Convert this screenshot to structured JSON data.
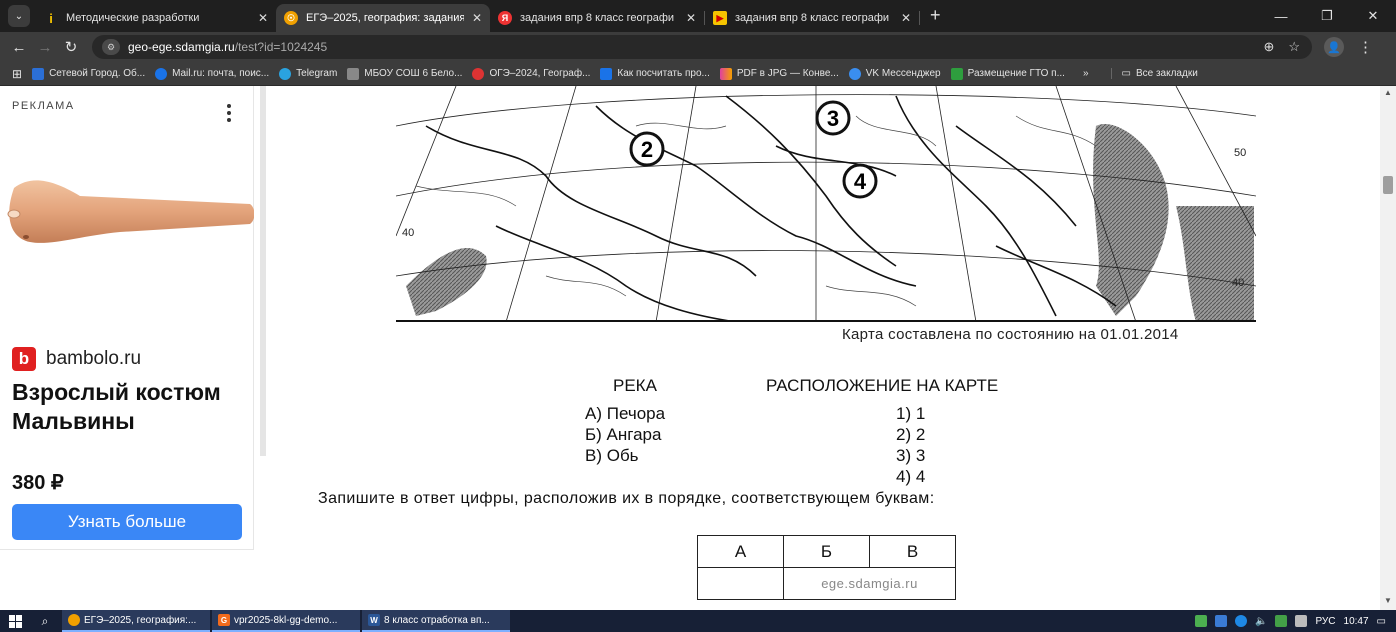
{
  "browser": {
    "tabs": [
      {
        "title": "Методические разработки",
        "favicon_color": "#f5c400",
        "favicon_glyph": "i",
        "active": false
      },
      {
        "title": "ЕГЭ–2025, география: задания",
        "favicon_color": "#f0a000",
        "favicon_glyph": "☉",
        "active": true
      },
      {
        "title": "задания впр 8 класс географи",
        "favicon_color": "#e33",
        "favicon_glyph": "Я",
        "active": false
      },
      {
        "title": "задания впр 8 класс географи",
        "favicon_color": "#f5c400",
        "favicon_glyph": "▶",
        "active": false
      }
    ],
    "url_domain": "geo-ege.sdamgia.ru",
    "url_path": "/test?id=1024245",
    "profile_initial": "👤"
  },
  "bookmarks": [
    {
      "label": "Сетевой Город. Об...",
      "color": "#2b6fd6"
    },
    {
      "label": "Mail.ru: почта, поис...",
      "color": "#1a73e8"
    },
    {
      "label": "Telegram",
      "color": "#2aa3e0"
    },
    {
      "label": "МБОУ СОШ 6 Бело...",
      "color": "#888"
    },
    {
      "label": "ОГЭ–2024, Географ...",
      "color": "#d33"
    },
    {
      "label": "Как посчитать про...",
      "color": "#1a73e8"
    },
    {
      "label": "PDF в JPG — Конве...",
      "color": "#e040a0"
    },
    {
      "label": "VK Мессенджер",
      "color": "#3a8ef0"
    },
    {
      "label": "Размещение ГТО п...",
      "color": "#2e9e3e"
    }
  ],
  "bookmarks_all": "Все закладки",
  "ad": {
    "label": "РЕКЛАМА",
    "brand": "bambolo.ru",
    "brand_logo": "b",
    "headline": "Взрослый костюм Мальвины",
    "price": "380 ₽",
    "cta": "Узнать больше"
  },
  "map": {
    "markers": [
      "2",
      "3",
      "4"
    ],
    "latitude_labels": [
      "40",
      "50",
      "40"
    ],
    "caption": "Карта составлена по состоянию на 01.01.2014"
  },
  "task": {
    "left_header": "РЕКА",
    "right_header": "РАСПОЛОЖЕНИЕ НА КАРТЕ",
    "rivers": [
      "А) Печора",
      "Б) Ангара",
      "В) Обь"
    ],
    "options": [
      "1) 1",
      "2) 2",
      "3) 3",
      "4) 4"
    ],
    "instruction": "Запишите в ответ цифры, расположив их в порядке, соответствующем буквам:",
    "answer_headers": [
      "А",
      "Б",
      "В"
    ],
    "watermark": "ege.sdamgia.ru"
  },
  "taskbar": {
    "tasks": [
      {
        "label": "ЕГЭ–2025, география:...",
        "color": "#f0a000"
      },
      {
        "label": "vpr2025-8kl-gg-demo...",
        "color": "#f26b1d"
      },
      {
        "label": "8 класс отработка вп...",
        "color": "#2b5797"
      }
    ],
    "lang": "РУС",
    "time": "10:47"
  }
}
